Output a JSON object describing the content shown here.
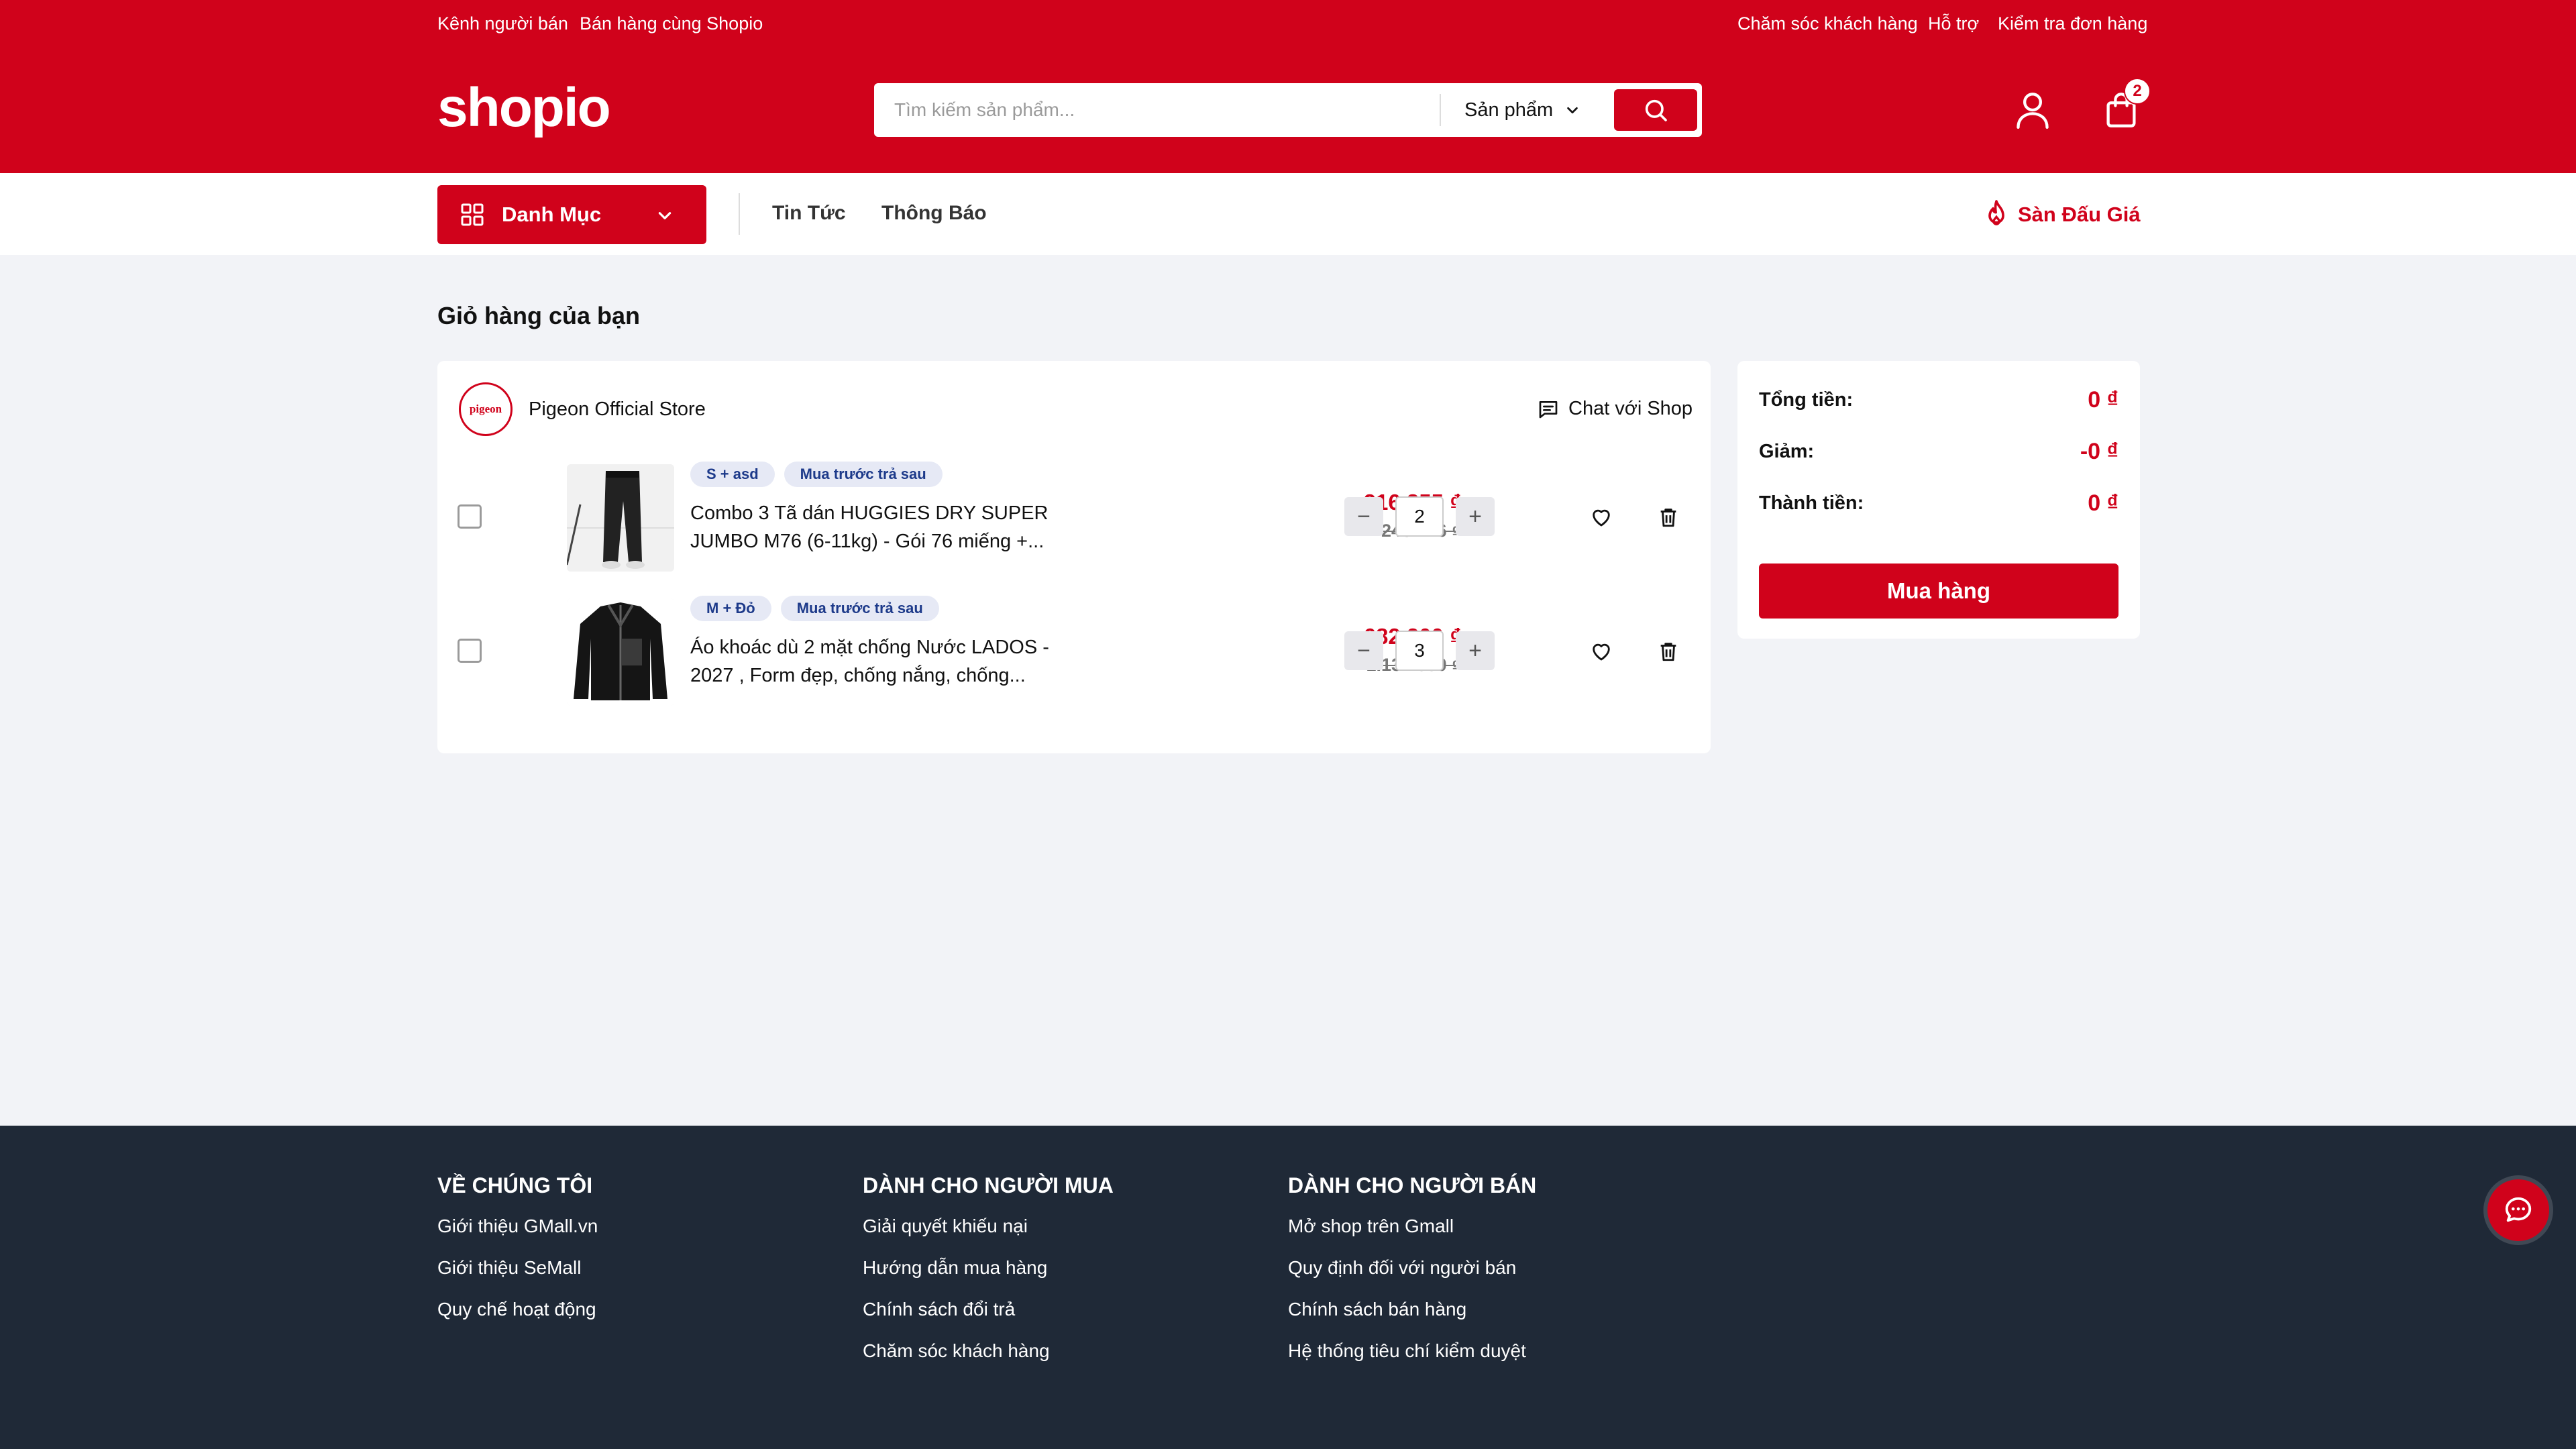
{
  "colors": {
    "brand": "#d0021b",
    "footer_bg": "#1f2937",
    "tag_bg": "#e6e9f5",
    "tag_text": "#1d3a8a"
  },
  "topbar": {
    "left_links": [
      "Kênh người bán",
      "Bán hàng cùng Shopio"
    ],
    "right_links": [
      "Chăm sóc khách hàng",
      "Hỗ trợ",
      "Kiểm tra đơn hàng"
    ]
  },
  "header": {
    "logo": "shopio",
    "search_placeholder": "Tìm kiếm sản phẩm...",
    "search_category": "Sản phẩm",
    "cart_count": "2",
    "icons": [
      "search-icon",
      "user-icon",
      "bag-icon"
    ]
  },
  "nav": {
    "category_button": "Danh Mục",
    "links": [
      "Tin Tức",
      "Thông Báo"
    ],
    "auction": "Sàn Đấu Giá"
  },
  "cart": {
    "title": "Giỏ hàng của bạn",
    "shop": {
      "name": "Pigeon Official Store",
      "logo_text": "pigeon",
      "chat": "Chat với Shop"
    },
    "items": [
      {
        "tags": [
          "S + asd",
          "Mua trước trả sau"
        ],
        "name": "Combo 3 Tã dán HUGGIES DRY SUPER JUMBO M76 (6-11kg) - Gói 76 miếng +...",
        "price": "216.855 ₫",
        "old_price": "246.426 ₫",
        "quantity": "2"
      },
      {
        "tags": [
          "M + Đỏ",
          "Mua trước trả sau"
        ],
        "name": "Áo khoác dù 2 mặt chống Nước LADOS - 2027 , Form đẹp, chống nắng, chống...",
        "price": "682.200 ₫",
        "old_price": "1.137.000 ₫",
        "quantity": "3"
      }
    ]
  },
  "summary": {
    "rows": [
      {
        "label": "Tổng tiền:",
        "value": "0 ₫"
      },
      {
        "label": "Giảm:",
        "value": "-0 ₫"
      },
      {
        "label": "Thành tiền:",
        "value": "0 ₫"
      }
    ],
    "buy_button": "Mua hàng"
  },
  "footer": {
    "columns": [
      {
        "heading": "VỀ CHÚNG TÔI",
        "links": [
          "Giới thiệu GMall.vn",
          "Giới thiệu SeMall",
          "Quy chế hoạt động"
        ]
      },
      {
        "heading": "DÀNH CHO NGƯỜI MUA",
        "links": [
          "Giải quyết khiếu nại",
          "Hướng dẫn mua hàng",
          "Chính sách đổi trả",
          "Chăm sóc khách hàng"
        ]
      },
      {
        "heading": "DÀNH CHO NGƯỜI BÁN",
        "links": [
          "Mở shop trên Gmall",
          "Quy định đối với người bán",
          "Chính sách bán hàng",
          "Hệ thống tiêu chí kiểm duyệt"
        ]
      }
    ]
  }
}
